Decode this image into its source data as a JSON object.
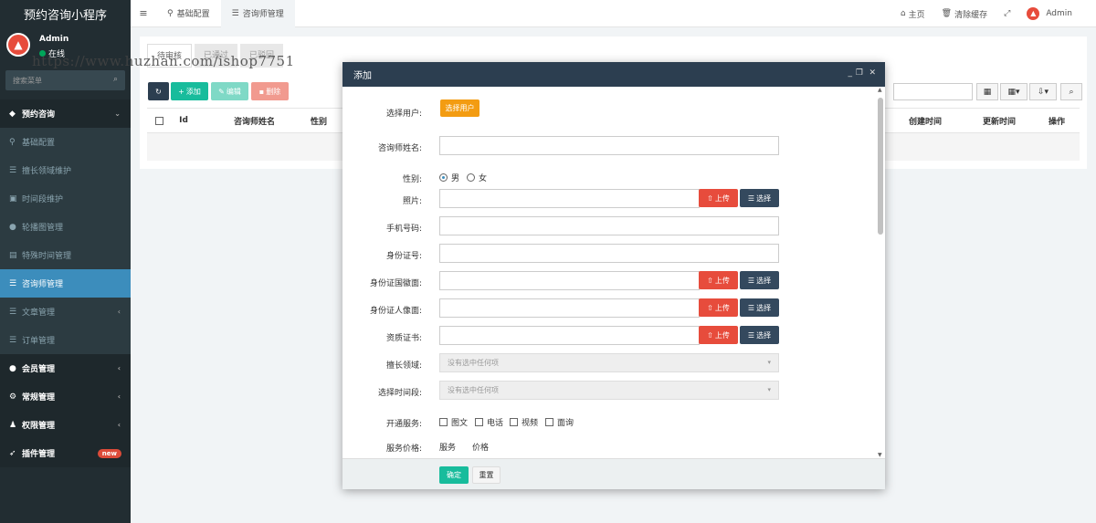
{
  "app": {
    "title": "预约咨询小程序"
  },
  "user": {
    "name": "Admin",
    "status": "在线"
  },
  "sidebar": {
    "search_placeholder": "搜索菜单",
    "items": [
      {
        "label": "预约咨询",
        "icon": "cubes-icon"
      },
      {
        "label": "基础配置",
        "icon": "map-marker-icon"
      },
      {
        "label": "擅长领域维护",
        "icon": "list-icon"
      },
      {
        "label": "时间段维护",
        "icon": "image-icon"
      },
      {
        "label": "轮播图管理",
        "icon": "circle-icon"
      },
      {
        "label": "特殊时间管理",
        "icon": "file-icon"
      },
      {
        "label": "咨询师管理",
        "icon": "list-icon"
      },
      {
        "label": "文章管理",
        "icon": "list-icon"
      },
      {
        "label": "订单管理",
        "icon": "list-icon"
      },
      {
        "label": "会员管理",
        "icon": "user-icon"
      },
      {
        "label": "常规管理",
        "icon": "cogs-icon"
      },
      {
        "label": "权限管理",
        "icon": "group-icon"
      },
      {
        "label": "插件管理",
        "icon": "rocket-icon",
        "badge": "new"
      }
    ]
  },
  "topbar": {
    "tabs": [
      "基础配置",
      "咨询师管理"
    ],
    "home": "主页",
    "clear_cache": "清除缓存",
    "admin": "Admin"
  },
  "panel": {
    "tabs": [
      "待审核",
      "已通过",
      "已驳回"
    ],
    "add": "添加",
    "edit": "编辑",
    "delete": "删除",
    "columns": [
      "Id",
      "咨询师姓名",
      "性别",
      "创建时间",
      "更新时间",
      "操作"
    ]
  },
  "watermark": "https://www.huzhan.com/ishop7751",
  "modal": {
    "title": "添加",
    "fields": {
      "select_user": "选择用户:",
      "select_user_btn": "选择用户",
      "name": "咨询师姓名:",
      "gender": "性别:",
      "male": "男",
      "female": "女",
      "photo": "照片:",
      "phone": "手机号码:",
      "id_number": "身份证号:",
      "id_front": "身份证国徽面:",
      "id_back": "身份证人像面:",
      "qualification": "资质证书:",
      "expertise": "擅长领域:",
      "time_slot": "选择时间段:",
      "services": "开通服务:",
      "service_price": "服务价格:",
      "price_col_service": "服务",
      "price_col_price": "价格",
      "none_selected": "没有选中任何项",
      "upload": "上传",
      "choose": "选择",
      "service_options": [
        "图文",
        "电话",
        "视频",
        "面询"
      ]
    },
    "ok": "确定",
    "reset": "重置"
  },
  "colors": {
    "sidebar_bg": "#222d32",
    "active": "#3c8dbc",
    "modal_head": "#2c3e50",
    "upload": "#e74c3c",
    "select_user": "#f39c12",
    "ok": "#18bc9c"
  }
}
